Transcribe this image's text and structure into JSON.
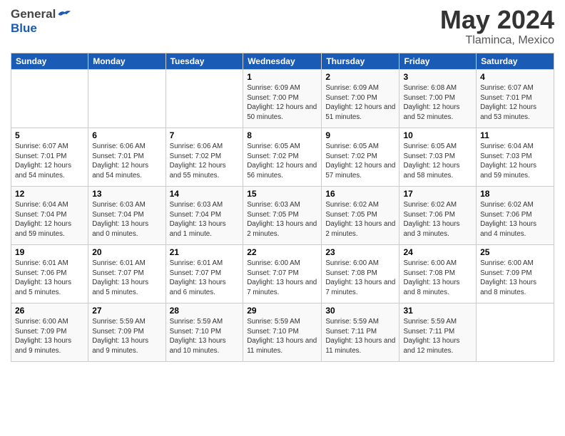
{
  "header": {
    "logo_general": "General",
    "logo_blue": "Blue",
    "title": "May 2024",
    "location": "Tlaminca, Mexico"
  },
  "days_of_week": [
    "Sunday",
    "Monday",
    "Tuesday",
    "Wednesday",
    "Thursday",
    "Friday",
    "Saturday"
  ],
  "weeks": [
    [
      {
        "day": "",
        "info": ""
      },
      {
        "day": "",
        "info": ""
      },
      {
        "day": "",
        "info": ""
      },
      {
        "day": "1",
        "sunrise": "6:09 AM",
        "sunset": "7:00 PM",
        "daylight": "12 hours and 50 minutes."
      },
      {
        "day": "2",
        "sunrise": "6:09 AM",
        "sunset": "7:00 PM",
        "daylight": "12 hours and 51 minutes."
      },
      {
        "day": "3",
        "sunrise": "6:08 AM",
        "sunset": "7:00 PM",
        "daylight": "12 hours and 52 minutes."
      },
      {
        "day": "4",
        "sunrise": "6:07 AM",
        "sunset": "7:01 PM",
        "daylight": "12 hours and 53 minutes."
      }
    ],
    [
      {
        "day": "5",
        "sunrise": "6:07 AM",
        "sunset": "7:01 PM",
        "daylight": "12 hours and 54 minutes."
      },
      {
        "day": "6",
        "sunrise": "6:06 AM",
        "sunset": "7:01 PM",
        "daylight": "12 hours and 54 minutes."
      },
      {
        "day": "7",
        "sunrise": "6:06 AM",
        "sunset": "7:02 PM",
        "daylight": "12 hours and 55 minutes."
      },
      {
        "day": "8",
        "sunrise": "6:05 AM",
        "sunset": "7:02 PM",
        "daylight": "12 hours and 56 minutes."
      },
      {
        "day": "9",
        "sunrise": "6:05 AM",
        "sunset": "7:02 PM",
        "daylight": "12 hours and 57 minutes."
      },
      {
        "day": "10",
        "sunrise": "6:05 AM",
        "sunset": "7:03 PM",
        "daylight": "12 hours and 58 minutes."
      },
      {
        "day": "11",
        "sunrise": "6:04 AM",
        "sunset": "7:03 PM",
        "daylight": "12 hours and 59 minutes."
      }
    ],
    [
      {
        "day": "12",
        "sunrise": "6:04 AM",
        "sunset": "7:04 PM",
        "daylight": "12 hours and 59 minutes."
      },
      {
        "day": "13",
        "sunrise": "6:03 AM",
        "sunset": "7:04 PM",
        "daylight": "13 hours and 0 minutes."
      },
      {
        "day": "14",
        "sunrise": "6:03 AM",
        "sunset": "7:04 PM",
        "daylight": "13 hours and 1 minute."
      },
      {
        "day": "15",
        "sunrise": "6:03 AM",
        "sunset": "7:05 PM",
        "daylight": "13 hours and 2 minutes."
      },
      {
        "day": "16",
        "sunrise": "6:02 AM",
        "sunset": "7:05 PM",
        "daylight": "13 hours and 2 minutes."
      },
      {
        "day": "17",
        "sunrise": "6:02 AM",
        "sunset": "7:06 PM",
        "daylight": "13 hours and 3 minutes."
      },
      {
        "day": "18",
        "sunrise": "6:02 AM",
        "sunset": "7:06 PM",
        "daylight": "13 hours and 4 minutes."
      }
    ],
    [
      {
        "day": "19",
        "sunrise": "6:01 AM",
        "sunset": "7:06 PM",
        "daylight": "13 hours and 5 minutes."
      },
      {
        "day": "20",
        "sunrise": "6:01 AM",
        "sunset": "7:07 PM",
        "daylight": "13 hours and 5 minutes."
      },
      {
        "day": "21",
        "sunrise": "6:01 AM",
        "sunset": "7:07 PM",
        "daylight": "13 hours and 6 minutes."
      },
      {
        "day": "22",
        "sunrise": "6:00 AM",
        "sunset": "7:07 PM",
        "daylight": "13 hours and 7 minutes."
      },
      {
        "day": "23",
        "sunrise": "6:00 AM",
        "sunset": "7:08 PM",
        "daylight": "13 hours and 7 minutes."
      },
      {
        "day": "24",
        "sunrise": "6:00 AM",
        "sunset": "7:08 PM",
        "daylight": "13 hours and 8 minutes."
      },
      {
        "day": "25",
        "sunrise": "6:00 AM",
        "sunset": "7:09 PM",
        "daylight": "13 hours and 8 minutes."
      }
    ],
    [
      {
        "day": "26",
        "sunrise": "6:00 AM",
        "sunset": "7:09 PM",
        "daylight": "13 hours and 9 minutes."
      },
      {
        "day": "27",
        "sunrise": "5:59 AM",
        "sunset": "7:09 PM",
        "daylight": "13 hours and 9 minutes."
      },
      {
        "day": "28",
        "sunrise": "5:59 AM",
        "sunset": "7:10 PM",
        "daylight": "13 hours and 10 minutes."
      },
      {
        "day": "29",
        "sunrise": "5:59 AM",
        "sunset": "7:10 PM",
        "daylight": "13 hours and 11 minutes."
      },
      {
        "day": "30",
        "sunrise": "5:59 AM",
        "sunset": "7:11 PM",
        "daylight": "13 hours and 11 minutes."
      },
      {
        "day": "31",
        "sunrise": "5:59 AM",
        "sunset": "7:11 PM",
        "daylight": "13 hours and 12 minutes."
      },
      {
        "day": "",
        "info": ""
      }
    ]
  ],
  "labels": {
    "sunrise": "Sunrise:",
    "sunset": "Sunset:",
    "daylight": "Daylight:"
  }
}
